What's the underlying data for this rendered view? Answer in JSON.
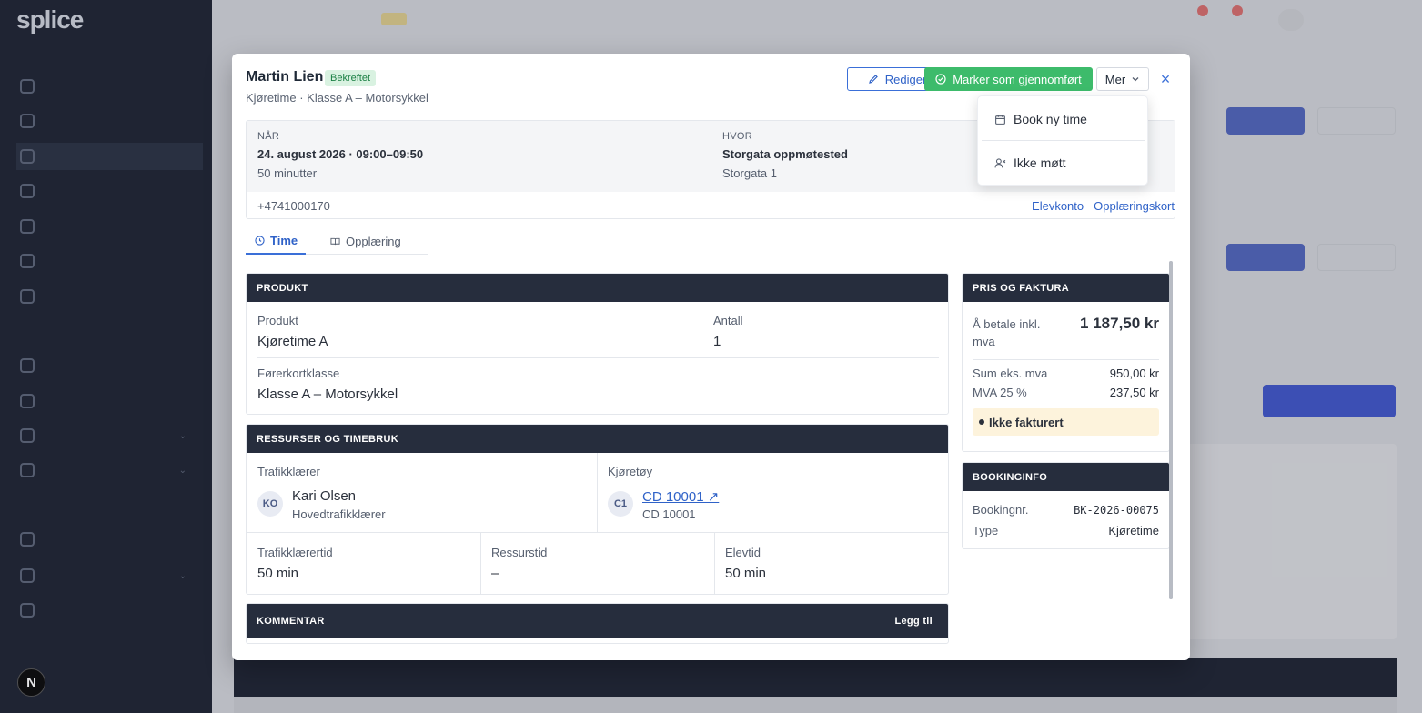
{
  "background": {
    "logo": "splice",
    "sidebar_sections": [
      "",
      "",
      ""
    ],
    "sidebar_items": [
      "",
      "",
      "",
      "",
      "",
      "",
      "",
      "",
      "",
      "",
      "",
      "",
      "",
      "",
      ""
    ]
  },
  "booking": {
    "name": "Martin Lien",
    "status": "Bekreftet",
    "subtitle": "Kjøretime · Klasse A – Motorsykkel"
  },
  "actions": {
    "edit": "Rediger",
    "mark_done": "Marker som gjennomført",
    "more": "Mer",
    "close": "×"
  },
  "dropdown": {
    "items": [
      {
        "label": "Book ny time",
        "icon": "calendar-icon"
      },
      {
        "label": "Ikke møtt",
        "icon": "user-x-icon"
      }
    ]
  },
  "info": {
    "when_label": "NÅR",
    "when_value": "24. august 2026 · 09:00–09:50",
    "when_duration": "50 minutter",
    "where_label": "HVOR",
    "where_value": "Storgata oppmøtested",
    "where_address": "Storgata 1",
    "phone": "+4741000170",
    "link_account": "Elevkonto",
    "link_training": "Opplæringskort"
  },
  "tabs": [
    {
      "label": "Time",
      "icon": "clock-icon",
      "active": true
    },
    {
      "label": "Opplæring",
      "icon": "book-icon",
      "active": false
    }
  ],
  "product": {
    "header": "PRODUKT",
    "product_label": "Produkt",
    "product_value": "Kjøretime A",
    "qty_label": "Antall",
    "qty_value": "1",
    "class_label": "Førerkortklasse",
    "class_value": "Klasse A – Motorsykkel"
  },
  "resources": {
    "header": "RESSURSER OG TIMEBRUK",
    "instructor_label": "Trafikklærer",
    "instructor_initials": "KO",
    "instructor_name": "Kari Olsen",
    "instructor_role": "Hovedtrafikklærer",
    "vehicle_label": "Kjøretøy",
    "vehicle_initials": "C1",
    "vehicle_link": "CD 10001 ↗",
    "vehicle_sub": "CD 10001",
    "time_instructor_label": "Trafikklærertid",
    "time_instructor_value": "50 min",
    "time_resource_label": "Ressurstid",
    "time_resource_value": "–",
    "time_student_label": "Elevtid",
    "time_student_value": "50 min"
  },
  "comment": {
    "header": "KOMMENTAR",
    "add": "Legg til"
  },
  "price": {
    "header": "PRIS OG FAKTURA",
    "to_pay_label": "Å betale inkl. mva",
    "to_pay_value": "1 187,50 kr",
    "sum_label": "Sum eks. mva",
    "sum_value": "950,00 kr",
    "vat_label": "MVA 25 %",
    "vat_value": "237,50 kr",
    "invoice_status": "Ikke fakturert"
  },
  "bookinginfo": {
    "header": "BOOKINGINFO",
    "number_label": "Bookingnr.",
    "number_value": "BK-2026-00075",
    "type_label": "Type",
    "type_value": "Kjøretime"
  },
  "colors": {
    "primary": "#3a6fd8",
    "success": "#3dbb6b",
    "dark": "#262d3d",
    "warning_bg": "#fdf3dc"
  }
}
